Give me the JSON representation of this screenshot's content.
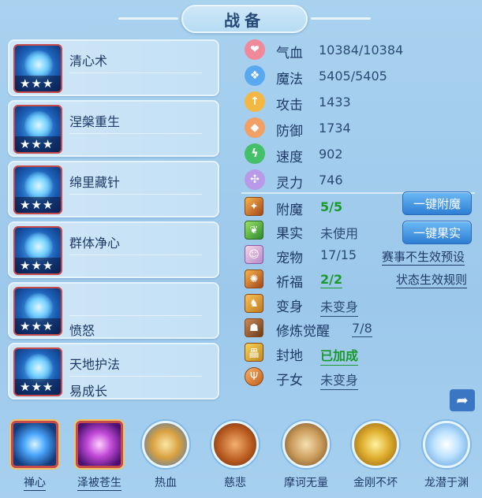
{
  "title": "战备",
  "skills": [
    {
      "name": "清心术",
      "sub": "",
      "stars": "★★★"
    },
    {
      "name": "涅槃重生",
      "sub": "",
      "stars": "★★★"
    },
    {
      "name": "绵里藏针",
      "sub": "",
      "stars": "★★★"
    },
    {
      "name": "群体净心",
      "sub": "",
      "stars": "★★★"
    },
    {
      "name": "",
      "sub": "愤怒",
      "stars": "★★★"
    },
    {
      "name": "天地护法",
      "sub": "易成长",
      "stars": "★★★"
    }
  ],
  "stats": [
    {
      "label": "气血",
      "value": "10384/10384",
      "icon": "heart-icon",
      "color": "#f08a9a",
      "glyph": "❤"
    },
    {
      "label": "魔法",
      "value": "5405/5405",
      "icon": "magic-icon",
      "color": "#5aa8f0",
      "glyph": "❖"
    },
    {
      "label": "攻击",
      "value": "1433",
      "icon": "attack-icon",
      "color": "#f3b844",
      "glyph": "↑"
    },
    {
      "label": "防御",
      "value": "1734",
      "icon": "defense-icon",
      "color": "#f2a065",
      "glyph": "◆"
    },
    {
      "label": "速度",
      "value": "902",
      "icon": "speed-icon",
      "color": "#44c06a",
      "glyph": "ϟ"
    },
    {
      "label": "灵力",
      "value": "746",
      "icon": "spirit-icon",
      "color": "#b99ae8",
      "glyph": "✣"
    }
  ],
  "features": [
    {
      "label": "附魔",
      "value": "5/5",
      "icon": "enchant-icon"
    },
    {
      "label": "果实",
      "value": "未使用",
      "icon": "fruit-icon"
    },
    {
      "label": "宠物",
      "value": "17/15",
      "icon": "pet-icon"
    },
    {
      "label": "祈福",
      "value": "2/2",
      "icon": "blessing-icon"
    },
    {
      "label": "变身",
      "value": "未变身",
      "icon": "transform-icon"
    },
    {
      "label": "修炼觉醒",
      "value": "7/8",
      "icon": "cultivation-icon"
    },
    {
      "label": "封地",
      "value": "已加成",
      "icon": "fief-icon"
    },
    {
      "label": "子女",
      "value": "未变身",
      "icon": "children-icon"
    }
  ],
  "buttons": {
    "enchant": "一键附魔",
    "fruit": "一键果实",
    "preset_link": "赛事不生效预设",
    "rule_link": "状态生效规则"
  },
  "bottom_skills": [
    {
      "label": "禅心"
    },
    {
      "label": "泽被苍生"
    },
    {
      "label": "热血"
    },
    {
      "label": "慈悲"
    },
    {
      "label": "摩诃无量"
    },
    {
      "label": "金刚不坏"
    },
    {
      "label": "龙潜于渊"
    }
  ],
  "colors": {
    "background": "#a9d2ef",
    "accent_button": "#2e7fd4",
    "green_value": "#1a9a2a",
    "text": "#1e3a66"
  }
}
